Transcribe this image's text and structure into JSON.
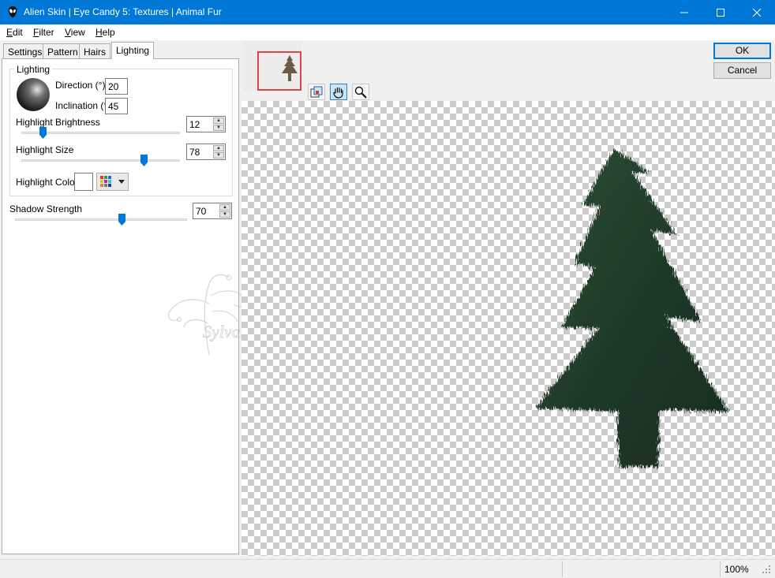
{
  "window": {
    "title": "Alien Skin | Eye Candy 5: Textures | Animal Fur"
  },
  "menu": [
    "Edit",
    "Filter",
    "View",
    "Help"
  ],
  "tabs": [
    "Settings",
    "Pattern",
    "Hairs",
    "Lighting"
  ],
  "active_tab": "Lighting",
  "lighting": {
    "group_label": "Lighting",
    "direction_label": "Direction (°)",
    "direction_value": "20",
    "inclination_label": "Inclination (°)",
    "inclination_value": "45",
    "highlight_brightness_label": "Highlight Brightness",
    "highlight_brightness_value": "12",
    "highlight_size_label": "Highlight Size",
    "highlight_size_value": "78",
    "highlight_color_label": "Highlight Color",
    "highlight_color": "#ffffff"
  },
  "shadow": {
    "label": "Shadow Strength",
    "value": "70"
  },
  "buttons": {
    "ok": "OK",
    "cancel": "Cancel"
  },
  "status": {
    "zoom": "100%"
  },
  "watermark_text": "Sylvane",
  "colors": {
    "titlebar": "#0078d7",
    "slider_thumb": "#0078d7",
    "fur_green": "#213d2b",
    "nav_rect": "#e04545"
  },
  "icons": {
    "app": "alien-skin-icon",
    "preview_tools": [
      "bounding-box-icon",
      "hand-pan-icon",
      "magnifier-zoom-icon"
    ]
  }
}
